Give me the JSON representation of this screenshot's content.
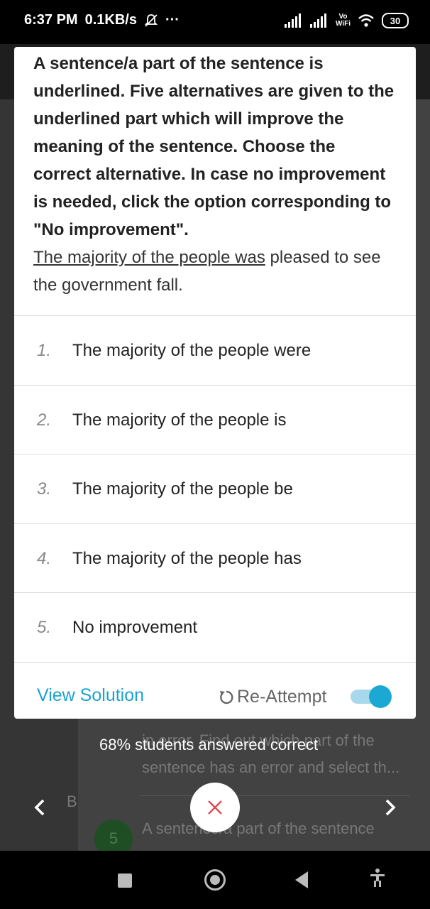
{
  "status_bar": {
    "time": "6:37 PM",
    "speed": "0.1KB/s",
    "more": "···",
    "vowifi_top": "Vo",
    "vowifi_bottom": "WiFi",
    "battery": "30"
  },
  "background": {
    "partial_line_1": "in error. Find out which part of the",
    "partial_line_2": "sentence has an error and select th...",
    "next_item_number": "5",
    "next_item_text": "A sentence/a part of the sentence",
    "left_letter": "B"
  },
  "question": {
    "instruction": "A sentence/a part of the sentence is underlined. Five alternatives are given to the underlined part which will improve the meaning of the sentence. Choose the correct alternative. In case no improvement is needed, click the option corresponding to \"No improvement\".",
    "sentence_underlined": "The majority of the people was",
    "sentence_rest": " pleased to see the government fall."
  },
  "options": [
    {
      "number": "1.",
      "text": "The majority of the people were"
    },
    {
      "number": "2.",
      "text": "The majority of the people is"
    },
    {
      "number": "3.",
      "text": "The majority of the people be"
    },
    {
      "number": "4.",
      "text": "The majority of the people has"
    },
    {
      "number": "5.",
      "text": "No improvement"
    }
  ],
  "footer": {
    "view_solution": "View Solution",
    "reattempt": "Re-Attempt",
    "reattempt_toggle_on": true
  },
  "stat_text": "68% students answered correct",
  "colors": {
    "accent": "#1aa3cf",
    "close_icon": "#e0484f"
  },
  "icons": {
    "close": "close-icon",
    "prev": "chevron-left-icon",
    "next": "chevron-right-icon",
    "reattempt": "refresh-icon"
  }
}
